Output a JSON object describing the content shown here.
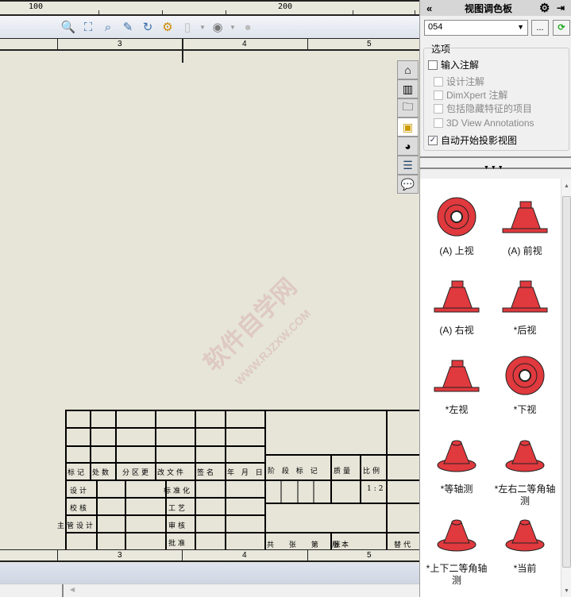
{
  "ruler": {
    "labels": [
      "100",
      "200"
    ]
  },
  "zones": {
    "top": [
      "3",
      "4",
      "5"
    ],
    "bottom": [
      "3",
      "4",
      "5"
    ]
  },
  "toolbar": {
    "icons": [
      "zoom-to-area-icon",
      "zoom-to-fit-icon",
      "zoom-selection-icon",
      "previous-view-icon",
      "redraw-icon",
      "view-orientation-icon",
      "display-style-icon",
      "hide-show-icon",
      "appearance-icon"
    ]
  },
  "side_tabs": [
    "home-icon",
    "parts-library-icon",
    "file-explorer-icon",
    "view-palette-icon",
    "appearances-icon",
    "custom-properties-icon",
    "forum-icon"
  ],
  "pane": {
    "title": "视图调色板",
    "combo_value": "054",
    "browse_label": "...",
    "options": {
      "legend": "选项",
      "import_annotations": "输入注解",
      "design_annotations": "设计注解",
      "dimxpert": "DimXpert 注解",
      "hidden_features": "包括隐藏特征的项目",
      "view3d": "3D View Annotations",
      "auto_projection": "自动开始投影视图"
    },
    "views": [
      "(A) 上视",
      "(A) 前视",
      "(A) 右视",
      "*后视",
      "*左视",
      "*下视",
      "*等轴测",
      "*左右二等角轴测",
      "*上下二等角轴测",
      "*当前"
    ]
  },
  "title_block": {
    "biaoji": "标记",
    "chushu": "处数",
    "fenqu": "分区更",
    "gaiwen": "改文件",
    "qianming": "签名",
    "nianyueri": "年 月 日",
    "jieduan": "阶 段 标 记",
    "zhiliang": "质量",
    "bili": "比例",
    "sheji": "设计",
    "biaozhunhua": "标准化",
    "scale": "1:2",
    "jiaohe": "校核",
    "gongyi": "工艺",
    "zhuguan": "主管设计",
    "shenhe": "审核",
    "pizhun": "批准",
    "gongzhang": "共 张 第 张",
    "banben": "版本",
    "tidai": "替代"
  },
  "watermark": "软件自学网 WWW.RJZXW.COM",
  "colors": {
    "model": "#e0393e",
    "accent": "#3a6ea5"
  }
}
